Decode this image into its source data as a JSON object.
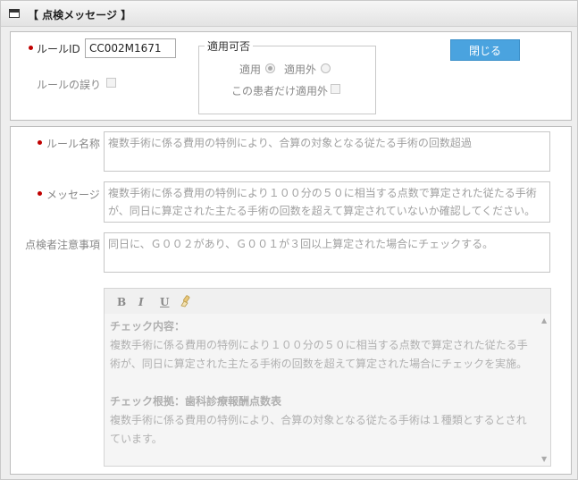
{
  "window": {
    "title": "【 点検メッセージ 】"
  },
  "form": {
    "rule_id_label": "ルールID",
    "rule_id_value": "CC002M1671",
    "rule_error_label": "ルールの誤り",
    "applicable": {
      "legend": "適用可否",
      "option_applicable": "適用",
      "option_not_applicable": "適用外",
      "selected": "適用",
      "patient_only_label": "この患者だけ適用外"
    },
    "close_label": "閉じる"
  },
  "details": {
    "rule_name_label": "ルール名称",
    "rule_name_value": "複数手術に係る費用の特例により、合算の対象となる従たる手術の回数超過",
    "message_label": "メッセージ",
    "message_value": "複数手術に係る費用の特例により１００分の５０に相当する点数で算定された従たる手術が、同日に算定された主たる手術の回数を超えて算定されていないか確認してください。",
    "notes_label": "点検者注意事項",
    "notes_value": "同日に、Ｇ００２があり、Ｇ００１が３回以上算定された場合にチェックする。",
    "editor": {
      "toolbar": {
        "bold": "B",
        "italic": "I",
        "underline": "U"
      },
      "check_content_heading": "チェック内容：",
      "check_content_line1": "複数手術に係る費用の特例により１００分の５０に相当する点数で算定された従たる手",
      "check_content_line2": "術が、同日に算定された主たる手術の回数を超えて算定された場合にチェックを実施。",
      "check_basis_heading": "チェック根拠：歯科診療報酬点数表",
      "check_basis_line1": "複数手術に係る費用の特例により、合算の対象となる従たる手術は１種類とするとされ",
      "check_basis_line2": "ています。"
    }
  },
  "colors": {
    "required_dot": "#c00000",
    "close_button": "#4aa3df"
  },
  "icons": [
    "window-icon",
    "required-dot-icon",
    "clear-format-icon",
    "scroll-up-icon",
    "scroll-down-icon"
  ]
}
